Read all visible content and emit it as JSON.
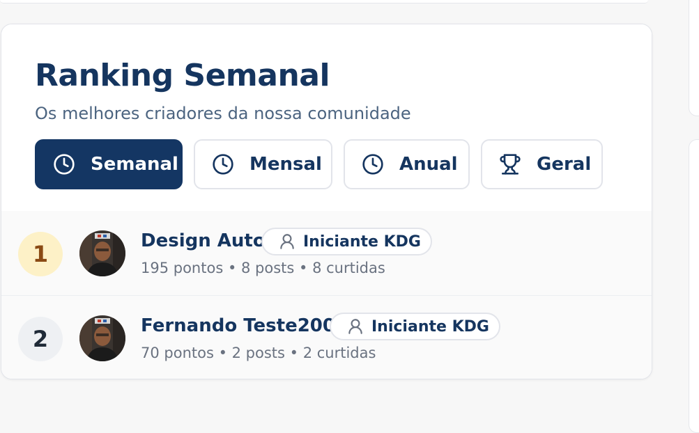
{
  "header": {
    "title": "Ranking Semanal",
    "subtitle": "Os melhores criadores da nossa comunidade"
  },
  "tabs": [
    {
      "label": "Semanal",
      "icon": "clock-icon",
      "active": true
    },
    {
      "label": "Mensal",
      "icon": "clock-icon",
      "active": false
    },
    {
      "label": "Anual",
      "icon": "clock-icon",
      "active": false
    },
    {
      "label": "Geral",
      "icon": "trophy-icon",
      "active": false
    }
  ],
  "ranking": [
    {
      "position": "1",
      "name": "Design Auto",
      "badge": "Iniciante KDG",
      "badge_icon": "user-icon",
      "stats": "195 pontos • 8 posts • 8 curtidas"
    },
    {
      "position": "2",
      "name": "Fernando Teste2000",
      "badge": "Iniciante KDG",
      "badge_icon": "user-icon",
      "stats": "70 pontos • 2 posts • 2 curtidas"
    }
  ],
  "colors": {
    "primary": "#143663",
    "gold_bg": "#fdf1c7",
    "gold_text": "#8a4a14",
    "silver_bg": "#eef0f3"
  }
}
